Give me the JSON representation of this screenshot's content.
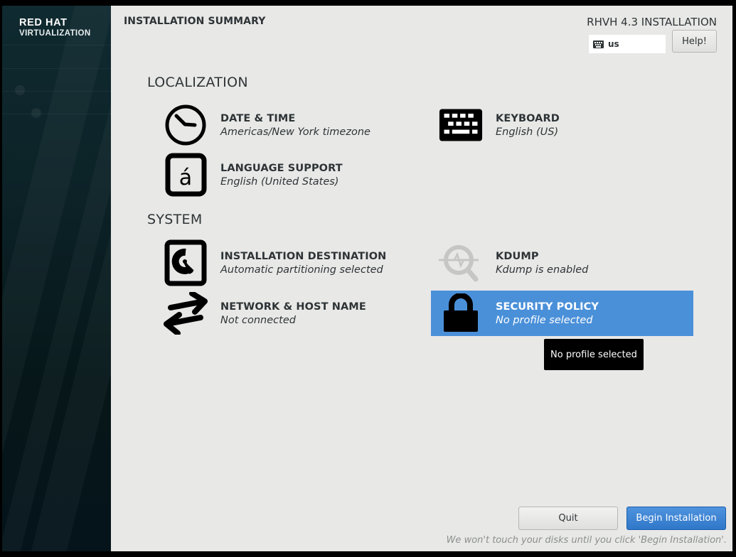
{
  "sidebar": {
    "brand_line1": "RED HAT",
    "brand_line2": "VIRTUALIZATION"
  },
  "header": {
    "page_title": "INSTALLATION SUMMARY",
    "product_title": "RHVH 4.3 INSTALLATION",
    "keyboard_layout": "us",
    "help_label": "Help!"
  },
  "sections": [
    {
      "title": "LOCALIZATION",
      "spokes": [
        {
          "id": "date-time",
          "title": "DATE & TIME",
          "status": "Americas/New York timezone",
          "icon": "clock-icon"
        },
        {
          "id": "keyboard",
          "title": "KEYBOARD",
          "status": "English (US)",
          "icon": "keyboard-icon"
        },
        {
          "id": "language-support",
          "title": "LANGUAGE SUPPORT",
          "status": "English (United States)",
          "icon": "language-icon"
        }
      ]
    },
    {
      "title": "SYSTEM",
      "spokes": [
        {
          "id": "installation-destination",
          "title": "INSTALLATION DESTINATION",
          "status": "Automatic partitioning selected",
          "icon": "harddisk-icon"
        },
        {
          "id": "kdump",
          "title": "KDUMP",
          "status": "Kdump is enabled",
          "icon": "kdump-search-icon"
        },
        {
          "id": "network-host",
          "title": "NETWORK & HOST NAME",
          "status": "Not connected",
          "icon": "network-arrows-icon"
        },
        {
          "id": "security-policy",
          "title": "SECURITY POLICY",
          "status": "No profile selected",
          "icon": "lock-icon",
          "selected": true
        }
      ]
    }
  ],
  "tooltip": "No profile selected",
  "footer": {
    "quit_label": "Quit",
    "begin_label": "Begin Installation",
    "note": "We won't touch your disks until you click 'Begin Installation'."
  },
  "colors": {
    "selected_spoke": "#4a90d9",
    "primary_button": "#3584e4",
    "background": "#e8e8e7",
    "sidebar": "#0c2227"
  }
}
